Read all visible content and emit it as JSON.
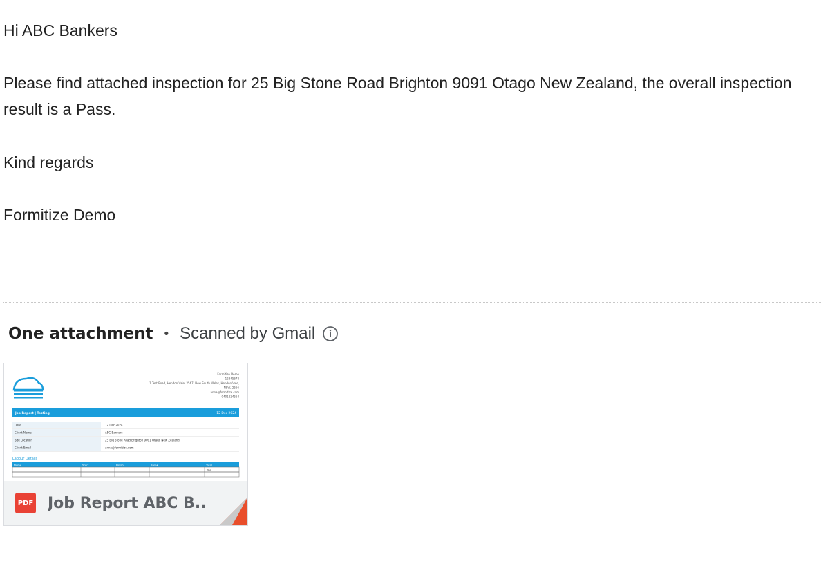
{
  "email": {
    "greeting": "Hi ABC Bankers",
    "message": "Please find attached inspection for 25 Big Stone Road Brighton 9091 Otago New Zealand, the overall inspection result is a Pass.",
    "closing": "Kind regards",
    "signature": "Formitize Demo"
  },
  "attachments": {
    "count_label": "One attachment",
    "separator": "•",
    "scanned_label": "Scanned by Gmail",
    "info_icon": "info-icon",
    "file": {
      "name": "Job Report ABC B...",
      "type_badge": "PDF",
      "icon": "pdf-icon"
    }
  },
  "thumbnail": {
    "company_lines": [
      "Formitize Demo",
      "12345678",
      "1 Test Road, Hendon Vale, 2567, New South Wales, Hendon Vale,",
      "NSW, 2566",
      "anna@formitize.com",
      "0401234564"
    ],
    "band_title": "Job Report | Testing",
    "band_date": "12 Dec 2024",
    "rows": [
      {
        "label": "Date",
        "value": "12 Dec 2024"
      },
      {
        "label": "Client Name",
        "value": "ABC Bankers"
      },
      {
        "label": "Site Location",
        "value": "25 Big Stone Road Brighton 9091 Otago New Zealand"
      },
      {
        "label": "Client Email",
        "value": "anna@formitize.com"
      }
    ],
    "section_title": "Labour Details",
    "table_headers": [
      "Name",
      "Start",
      "Finish",
      "Break",
      "Total"
    ],
    "table_total": "0hr",
    "accent_color": "#1a9ddb"
  }
}
